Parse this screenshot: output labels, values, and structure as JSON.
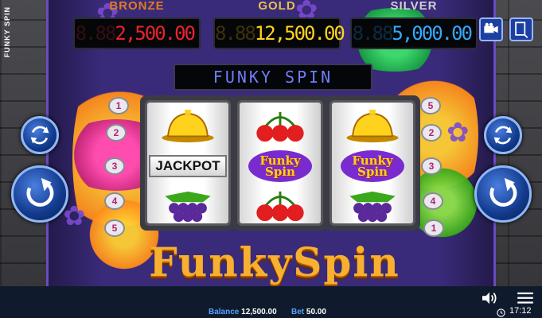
{
  "game": {
    "side_title": "FUNKY SPIN",
    "logo": "FunkySpin"
  },
  "jackpots": [
    {
      "label": "BRONZE",
      "ghost": "8.88",
      "value": "2,500.00",
      "color": "#e8242a",
      "title_color": "#e27a1f"
    },
    {
      "label": "GOLD",
      "ghost": "8.88",
      "value": "12,500.00",
      "color": "#ffd21e",
      "title_color": "#e6c24a"
    },
    {
      "label": "SILVER",
      "ghost": "8.88",
      "value": "5,000.00",
      "color": "#33a9ff",
      "title_color": "#d0d0d0"
    }
  ],
  "banner": {
    "text": "FUNKY SPIN"
  },
  "reels": [
    {
      "symbols": [
        "bell",
        "jackpot",
        "grapes"
      ]
    },
    {
      "symbols": [
        "cherries",
        "funky-spin",
        "cherries"
      ]
    },
    {
      "symbols": [
        "bell",
        "funky-spin",
        "grapes"
      ]
    }
  ],
  "symbol_text": {
    "jackpot": "JACKPOT",
    "funky_spin": "Funky Spin"
  },
  "paylines": {
    "left": [
      "1",
      "2",
      "3",
      "4",
      "5"
    ],
    "right": [
      "5",
      "2",
      "3",
      "4",
      "1"
    ]
  },
  "status": {
    "balance_label": "Balance",
    "balance_value": "12,500.00",
    "bet_label": "Bet",
    "bet_value": "50.00",
    "time": "17:12"
  },
  "icons": {
    "video": "video-camera-icon",
    "settings": "settings-panel-icon",
    "sound": "speaker-icon",
    "menu": "hamburger-menu-icon",
    "clock": "clock-icon"
  }
}
